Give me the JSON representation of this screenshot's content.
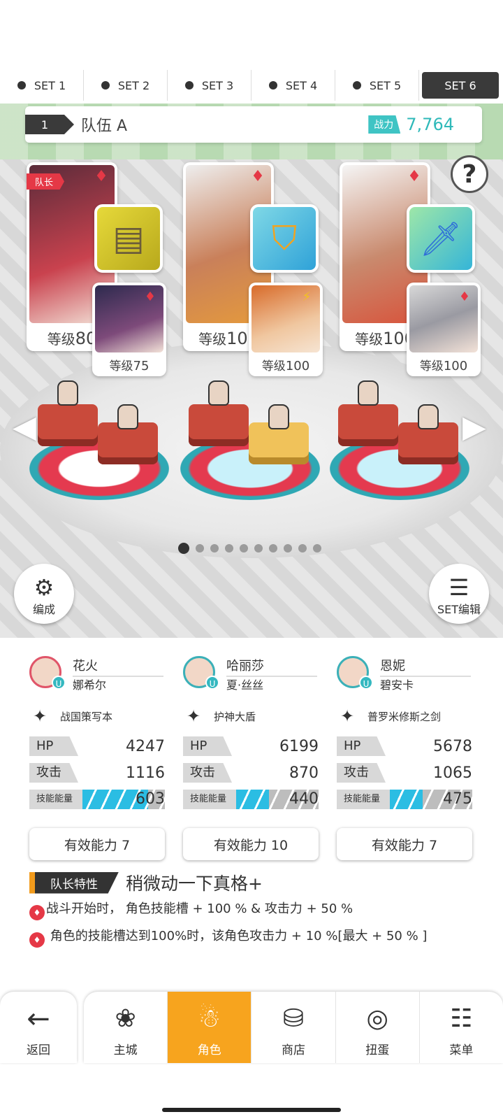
{
  "set_tabs": [
    "SET 1",
    "SET 2",
    "SET 3",
    "SET 4",
    "SET 5",
    "SET 6"
  ],
  "active_set": "SET 6",
  "team": {
    "number": "1",
    "name": "队伍 A",
    "power_label": "战力",
    "power_value": "7,764"
  },
  "leader_tag": "队长",
  "help_symbol": "?",
  "cards": [
    {
      "level_label": "等级",
      "level": "80",
      "element": "diamond"
    },
    {
      "level_label": "等级",
      "level": "75",
      "element": "diamond"
    },
    {
      "level_label": "等级",
      "level": "100",
      "element": "diamond"
    },
    {
      "level_label": "等级",
      "level": "100",
      "element": "lightning"
    },
    {
      "level_label": "等级",
      "level": "100",
      "element": "diamond"
    },
    {
      "level_label": "等级",
      "level": "100",
      "element": "diamond"
    }
  ],
  "pager": {
    "total": 10,
    "current": 1
  },
  "buttons": {
    "formation": "编成",
    "set_edit": "SET编辑"
  },
  "characters": [
    {
      "name": "花火",
      "sub": "娜希尔",
      "equipment": "战国策写本",
      "hp_label": "HP",
      "hp": "4247",
      "atk_label": "攻击",
      "atk": "1116",
      "energy_label": "技能能量",
      "energy": "603",
      "energy_fill": 0.8,
      "ability": "有效能力 7"
    },
    {
      "name": "哈丽莎",
      "sub": "夏·丝丝",
      "equipment": "护神大盾",
      "hp_label": "HP",
      "hp": "6199",
      "atk_label": "攻击",
      "atk": "870",
      "energy_label": "技能能量",
      "energy": "440",
      "energy_fill": 0.4,
      "ability": "有效能力 10"
    },
    {
      "name": "恩妮",
      "sub": "碧安卡",
      "equipment": "普罗米修斯之剑",
      "hp_label": "HP",
      "hp": "5678",
      "atk_label": "攻击",
      "atk": "1065",
      "energy_label": "技能能量",
      "energy": "475",
      "energy_fill": 0.4,
      "ability": "有效能力 7"
    }
  ],
  "leader_skill": {
    "tag": "队长特性",
    "title": "稍微动一下真格+",
    "line1": "战斗开始时，  角色技能槽 + 100 % & 攻击力 + 50 %",
    "line2": "  角色的技能槽达到100%时，该角色攻击力 + 10 %[最大 + 50 % ]"
  },
  "nav": {
    "back": "返回",
    "items": [
      "主城",
      "角色",
      "商店",
      "扭蛋",
      "菜单"
    ],
    "active": "角色"
  },
  "colors": {
    "accent_orange": "#f7a41e",
    "power_teal": "#3fc4c4",
    "element_red": "#e53846",
    "energy_blue": "#2bbde3"
  }
}
